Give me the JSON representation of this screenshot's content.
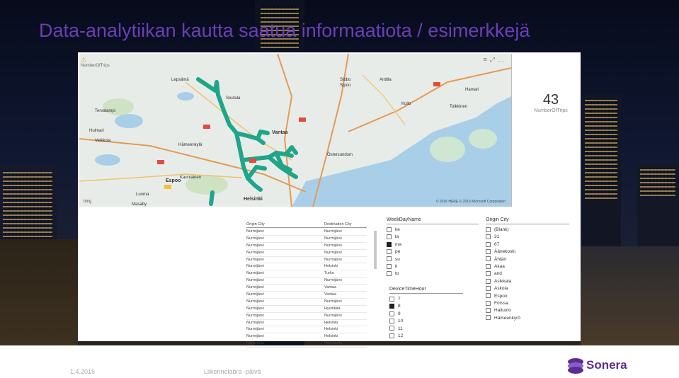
{
  "slide": {
    "title": "Data-analytiikan kautta saatua informaatiota / esimerkkejä",
    "footer_date": "1.4.2016",
    "footer_event": "Liikennelabra -päivä",
    "logo_text": "Sonera"
  },
  "report": {
    "map": {
      "label": "NumberOfTrips",
      "places": [
        "Lepsämä",
        "Seutula",
        "Sibbo",
        "Sipoo",
        "Anttila",
        "Hamari",
        "Kullo",
        "Tolkkinen",
        "Tervalampi",
        "Vantaa",
        "Hämeenkylä",
        "Hulmari",
        "Veikkola",
        "Östersundom",
        "Espoo",
        "Kauniainen",
        "Helsinki",
        "Luoma",
        "Masaby"
      ],
      "attribution": "© 2016 HERE   © 2016 Microsoft Corporation",
      "bing": "bing"
    },
    "card": {
      "value": "43",
      "label": "NumberOfTrips"
    },
    "table": {
      "columns": [
        "Origin City",
        "Destination City"
      ],
      "rows": [
        [
          "Nurmijärvi",
          "Nurmijärvi"
        ],
        [
          "Nurmijärvi",
          "Nurmijärvi"
        ],
        [
          "Nurmijärvi",
          "Nurmijärvi"
        ],
        [
          "Nurmijärvi",
          "Nurmijärvi"
        ],
        [
          "Nurmijärvi",
          "Nurmijärvi"
        ],
        [
          "Nurmijärvi",
          "Helsinki"
        ],
        [
          "Nurmijärvi",
          "Turku"
        ],
        [
          "Nurmijärvi",
          "Nurmijärvi"
        ],
        [
          "Nurmijärvi",
          "Vantaa"
        ],
        [
          "Nurmijärvi",
          "Vantaa"
        ],
        [
          "Nurmijärvi",
          "Nurmijärvi"
        ],
        [
          "Nurmijärvi",
          "Hyvinkää"
        ],
        [
          "Nurmijärvi",
          "Nurmijärvi"
        ],
        [
          "Nurmijärvi",
          "Helsinki"
        ],
        [
          "Nurmijärvi",
          "Helsinki"
        ],
        [
          "Nurmijärvi",
          "Helsinki"
        ],
        [
          "Nurmijärvi",
          "Nurmijärvi"
        ]
      ]
    },
    "weekday_slicer": {
      "title": "WeekDayName",
      "items": [
        {
          "label": "ke",
          "checked": false
        },
        {
          "label": "la",
          "checked": false
        },
        {
          "label": "ma",
          "checked": true
        },
        {
          "label": "pe",
          "checked": false
        },
        {
          "label": "su",
          "checked": false
        },
        {
          "label": "ti",
          "checked": false
        },
        {
          "label": "to",
          "checked": false
        }
      ]
    },
    "hour_slicer": {
      "title": "DeviceTimeHour",
      "items": [
        {
          "label": "7",
          "checked": false
        },
        {
          "label": "8",
          "checked": true
        },
        {
          "label": "9",
          "checked": false
        },
        {
          "label": "10",
          "checked": false
        },
        {
          "label": "11",
          "checked": false
        },
        {
          "label": "12",
          "checked": false
        }
      ]
    },
    "origin_slicer": {
      "title": "Origin City",
      "items": [
        {
          "label": "(Blank)",
          "checked": false
        },
        {
          "label": "31",
          "checked": false
        },
        {
          "label": "67",
          "checked": false
        },
        {
          "label": "Äänekoski",
          "checked": false
        },
        {
          "label": "Ähtäri",
          "checked": false
        },
        {
          "label": "Akaa",
          "checked": false
        },
        {
          "label": "and",
          "checked": false
        },
        {
          "label": "Asikkala",
          "checked": false
        },
        {
          "label": "Askola",
          "checked": false
        },
        {
          "label": "Espoo",
          "checked": false
        },
        {
          "label": "Forssa",
          "checked": false
        },
        {
          "label": "Hailuoto",
          "checked": false
        },
        {
          "label": "Hämeenkyrö",
          "checked": false
        }
      ]
    }
  },
  "colors": {
    "title": "#6a3fb5",
    "route": "#1fa58a",
    "logo": "#5c2d91"
  }
}
